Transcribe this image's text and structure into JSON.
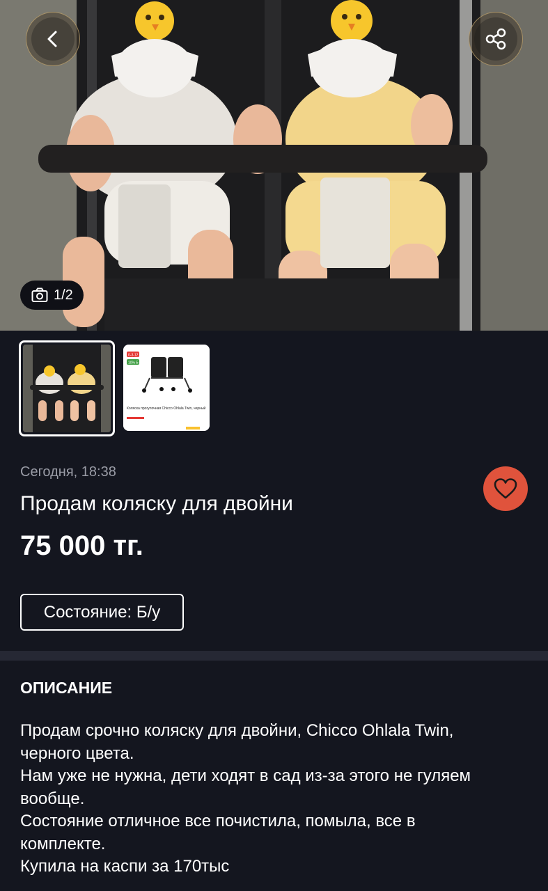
{
  "photo": {
    "counter": "1/2",
    "current": 1,
    "total": 2
  },
  "thumbnail_2": {
    "badge_1": "0-3-12",
    "badge_2": "10% Б",
    "product_title": "Коляска прогулочная Chicco Ohlala Twin, черный"
  },
  "listing": {
    "date": "Сегодня, 18:38",
    "title": "Продам коляску для двойни",
    "price": "75 000 тг.",
    "condition": "Состояние: Б/у"
  },
  "description": {
    "heading": "ОПИСАНИЕ",
    "lines": [
      "Продам срочно коляску для двойни, Chicco Ohlala Twin,",
      "черного цвета.",
      "Нам уже не нужна, дети ходят в сад из-за этого не гуляем",
      "вообще.",
      "Состояние отличное все почистила, помыла, все в",
      "комплекте.",
      "Купила на каспи за 170тыс"
    ]
  },
  "icons": {
    "back": "chevron-left-icon",
    "share": "share-icon",
    "camera": "camera-icon",
    "favorite": "heart-icon"
  },
  "colors": {
    "background": "#14161f",
    "favorite_button": "#e0533c",
    "divider": "#262834",
    "muted_text": "#9a9ca6"
  }
}
